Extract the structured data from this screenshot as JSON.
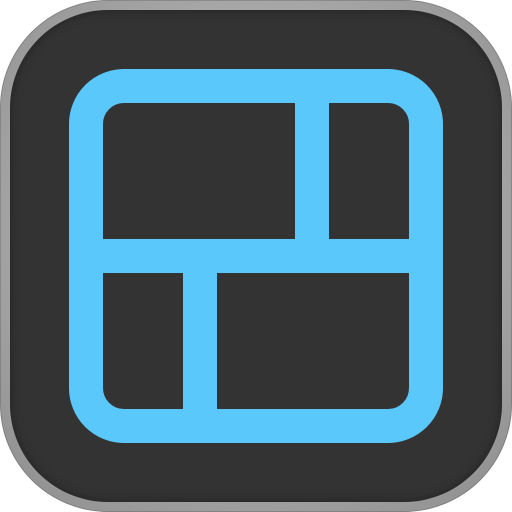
{
  "app": {
    "icon_name": "collage-layout-icon",
    "colors": {
      "background": "#333333",
      "bezel": "#a9a9a9",
      "accent": "#5ac8fa"
    }
  }
}
